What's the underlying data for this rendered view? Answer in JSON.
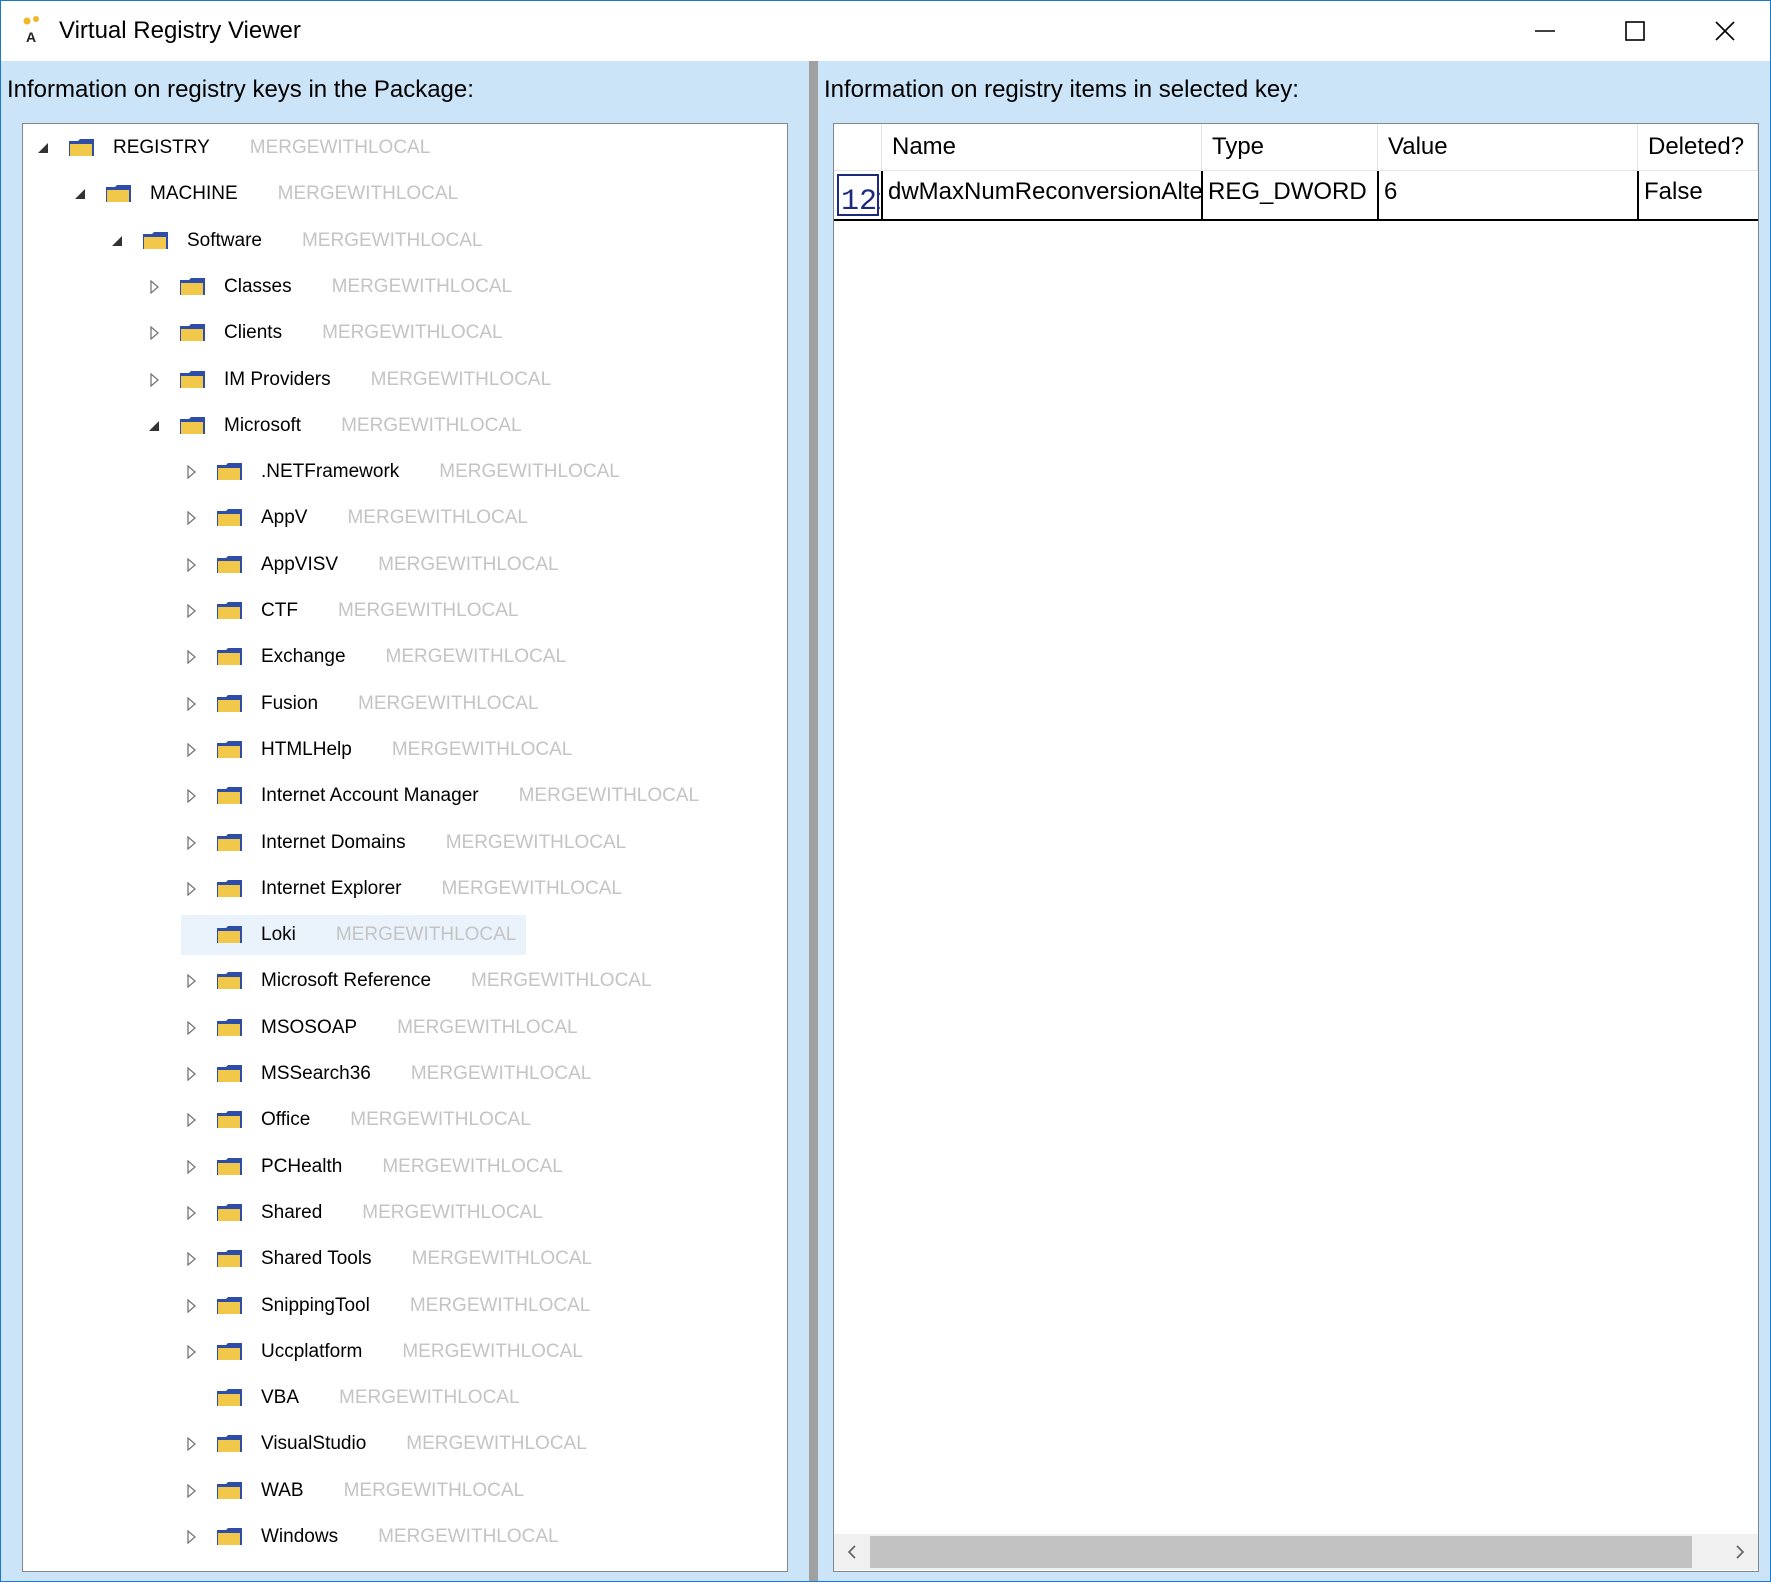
{
  "window": {
    "title": "Virtual Registry Viewer"
  },
  "left_pane": {
    "label": "Information on registry keys in the Package:"
  },
  "right_pane": {
    "label": "Information on registry items in selected key:"
  },
  "tree": [
    {
      "label": "REGISTRY",
      "policy": "MERGEWITHLOCAL",
      "depth": 0,
      "state": "expanded"
    },
    {
      "label": "MACHINE",
      "policy": "MERGEWITHLOCAL",
      "depth": 1,
      "state": "expanded"
    },
    {
      "label": "Software",
      "policy": "MERGEWITHLOCAL",
      "depth": 2,
      "state": "expanded"
    },
    {
      "label": "Classes",
      "policy": "MERGEWITHLOCAL",
      "depth": 3,
      "state": "collapsed"
    },
    {
      "label": "Clients",
      "policy": "MERGEWITHLOCAL",
      "depth": 3,
      "state": "collapsed"
    },
    {
      "label": "IM Providers",
      "policy": "MERGEWITHLOCAL",
      "depth": 3,
      "state": "collapsed"
    },
    {
      "label": "Microsoft",
      "policy": "MERGEWITHLOCAL",
      "depth": 3,
      "state": "expanded"
    },
    {
      "label": ".NETFramework",
      "policy": "MERGEWITHLOCAL",
      "depth": 4,
      "state": "collapsed"
    },
    {
      "label": "AppV",
      "policy": "MERGEWITHLOCAL",
      "depth": 4,
      "state": "collapsed"
    },
    {
      "label": "AppVISV",
      "policy": "MERGEWITHLOCAL",
      "depth": 4,
      "state": "collapsed"
    },
    {
      "label": "CTF",
      "policy": "MERGEWITHLOCAL",
      "depth": 4,
      "state": "collapsed"
    },
    {
      "label": "Exchange",
      "policy": "MERGEWITHLOCAL",
      "depth": 4,
      "state": "collapsed"
    },
    {
      "label": "Fusion",
      "policy": "MERGEWITHLOCAL",
      "depth": 4,
      "state": "collapsed"
    },
    {
      "label": "HTMLHelp",
      "policy": "MERGEWITHLOCAL",
      "depth": 4,
      "state": "collapsed"
    },
    {
      "label": "Internet Account Manager",
      "policy": "MERGEWITHLOCAL",
      "depth": 4,
      "state": "collapsed"
    },
    {
      "label": "Internet Domains",
      "policy": "MERGEWITHLOCAL",
      "depth": 4,
      "state": "collapsed"
    },
    {
      "label": "Internet Explorer",
      "policy": "MERGEWITHLOCAL",
      "depth": 4,
      "state": "collapsed"
    },
    {
      "label": "Loki",
      "policy": "MERGEWITHLOCAL",
      "depth": 4,
      "state": "leaf",
      "selected": true
    },
    {
      "label": "Microsoft Reference",
      "policy": "MERGEWITHLOCAL",
      "depth": 4,
      "state": "collapsed"
    },
    {
      "label": "MSOSOAP",
      "policy": "MERGEWITHLOCAL",
      "depth": 4,
      "state": "collapsed"
    },
    {
      "label": "MSSearch36",
      "policy": "MERGEWITHLOCAL",
      "depth": 4,
      "state": "collapsed"
    },
    {
      "label": "Office",
      "policy": "MERGEWITHLOCAL",
      "depth": 4,
      "state": "collapsed"
    },
    {
      "label": "PCHealth",
      "policy": "MERGEWITHLOCAL",
      "depth": 4,
      "state": "collapsed"
    },
    {
      "label": "Shared",
      "policy": "MERGEWITHLOCAL",
      "depth": 4,
      "state": "collapsed"
    },
    {
      "label": "Shared Tools",
      "policy": "MERGEWITHLOCAL",
      "depth": 4,
      "state": "collapsed"
    },
    {
      "label": "SnippingTool",
      "policy": "MERGEWITHLOCAL",
      "depth": 4,
      "state": "collapsed"
    },
    {
      "label": "Uccplatform",
      "policy": "MERGEWITHLOCAL",
      "depth": 4,
      "state": "collapsed"
    },
    {
      "label": "VBA",
      "policy": "MERGEWITHLOCAL",
      "depth": 4,
      "state": "leaf"
    },
    {
      "label": "VisualStudio",
      "policy": "MERGEWITHLOCAL",
      "depth": 4,
      "state": "collapsed"
    },
    {
      "label": "WAB",
      "policy": "MERGEWITHLOCAL",
      "depth": 4,
      "state": "collapsed"
    },
    {
      "label": "Windows",
      "policy": "MERGEWITHLOCAL",
      "depth": 4,
      "state": "collapsed"
    }
  ],
  "grid": {
    "columns": [
      "Name",
      "Type",
      "Value",
      "Deleted?"
    ],
    "rows": [
      {
        "icon": "dword-value-icon",
        "name": "dwMaxNumReconversionAlte",
        "type": "REG_DWORD",
        "value": "6",
        "deleted": "False"
      }
    ]
  },
  "colors": {
    "accent": "#1979ca",
    "pane_bg": "#cce4f7",
    "folder_yellow": "#f2c84b",
    "folder_blue": "#2e4da8",
    "policy_text": "#c4c4c4"
  }
}
